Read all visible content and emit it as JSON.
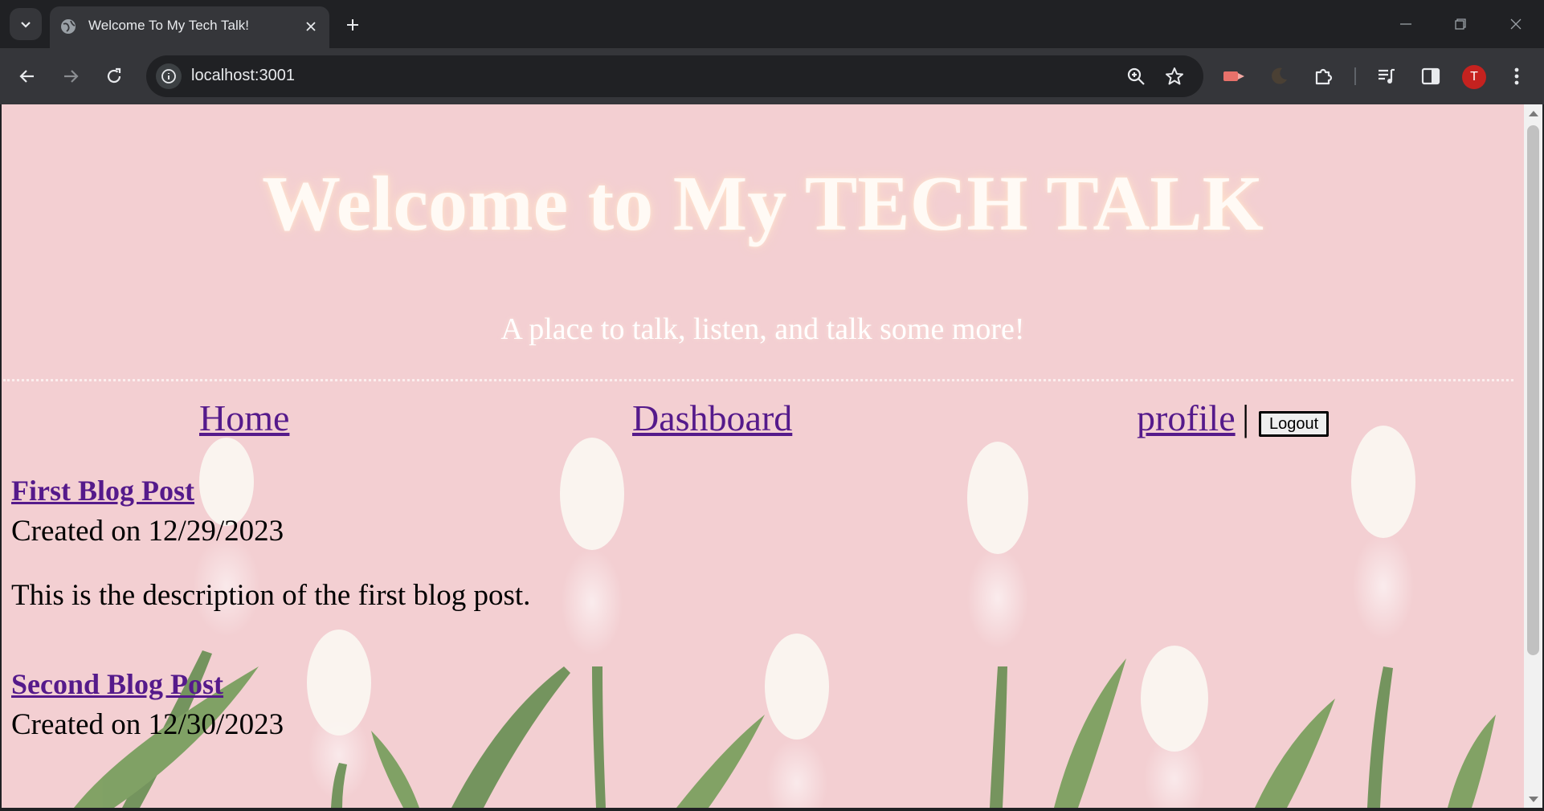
{
  "browser": {
    "tab_title": "Welcome To My Tech Talk!",
    "url": "localhost:3001",
    "profile_initial": "T",
    "icons": [
      "tab-search-icon",
      "globe-icon",
      "close-icon",
      "plus-icon",
      "minimize-icon",
      "restore-icon",
      "window-close-icon",
      "back-icon",
      "forward-icon",
      "reload-icon",
      "site-info-icon",
      "zoom-icon",
      "star-icon",
      "extension-icon",
      "puzzle-icon",
      "media-icon",
      "side-panel-icon",
      "more-menu-icon"
    ],
    "colors": {
      "frame": "#202124",
      "toolbar": "#35363a",
      "avatar": "#c5221f"
    }
  },
  "page": {
    "title": "Welcome to My TECH TALK",
    "subtitle": "A place to talk, listen, and talk some more!",
    "nav": {
      "home": "Home",
      "dashboard": "Dashboard",
      "profile": "profile",
      "separator": "|",
      "logout": "Logout"
    },
    "posts": [
      {
        "title": "First Blog Post",
        "created": "Created on 12/29/2023",
        "description": "This is the description of the first blog post."
      },
      {
        "title": "Second Blog Post",
        "created": "Created on 12/30/2023"
      }
    ],
    "colors": {
      "background": "#f3cfd2",
      "link": "#551a8b",
      "title_text": "#fffaf5"
    }
  }
}
